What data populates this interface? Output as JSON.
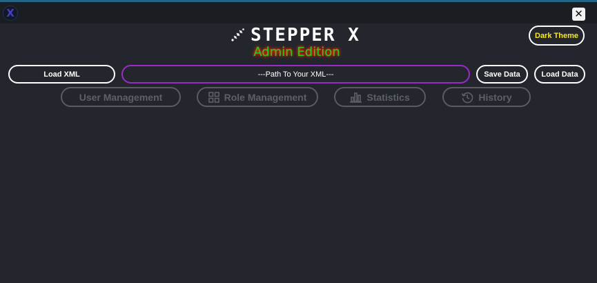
{
  "window": {
    "app_icon": "x-logo-icon",
    "app_icon_glyph": "X",
    "close_glyph": "✕",
    "close_icon": "close-icon"
  },
  "header": {
    "logo_icon": "stepper-logo-icon",
    "logo_text": "STEPPER X",
    "subtitle": "Admin Edition",
    "theme_button_label": "Dark Theme"
  },
  "toolbar": {
    "load_xml_label": "Load XML",
    "path_placeholder": "---Path To Your XML---",
    "path_value": "",
    "save_data_label": "Save Data",
    "load_data_label": "Load Data"
  },
  "tabs": [
    {
      "label": "User Management",
      "icon": ""
    },
    {
      "label": "Role Management",
      "icon": "grid-icon"
    },
    {
      "label": "Statistics",
      "icon": "bar-chart-icon"
    },
    {
      "label": "History",
      "icon": "history-icon"
    }
  ],
  "colors": {
    "background": "#23272d",
    "title_bar": "#1a1d21",
    "accent_purple": "#9b2bc7",
    "subtitle_green": "#27c81e",
    "subtitle_glow": "#ff2a00",
    "theme_label": "#f5e62a",
    "tab_disabled": "#5d6167"
  }
}
